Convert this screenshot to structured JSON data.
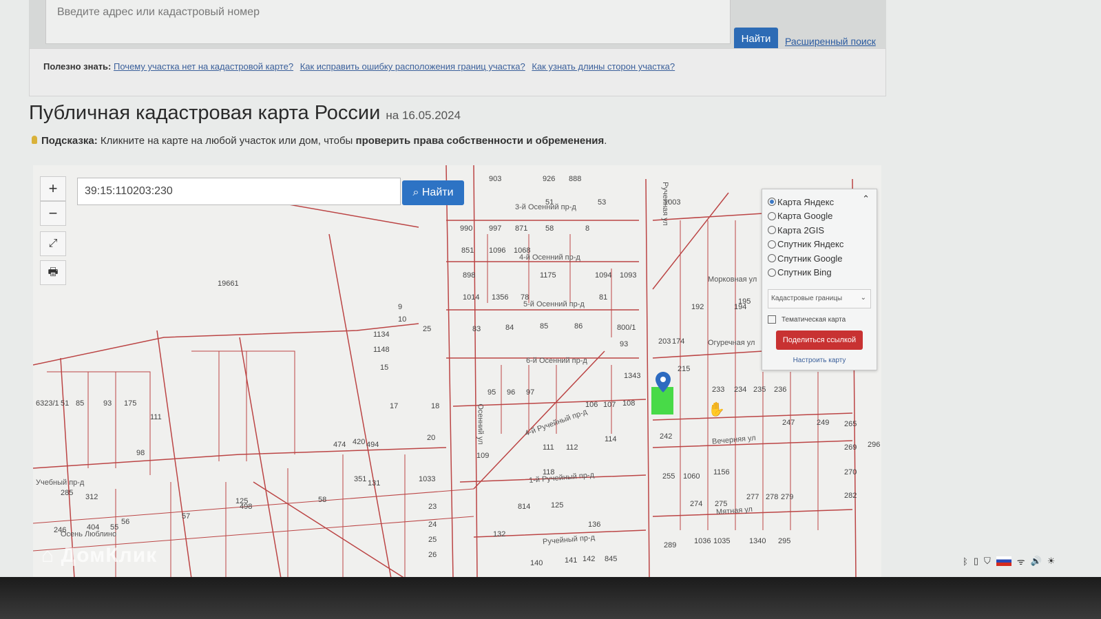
{
  "top": {
    "address_placeholder": "Введите адрес или кадастровый номер",
    "find": "Найти",
    "advanced": "Расширенный поиск"
  },
  "useful": {
    "label": "Полезно знать:",
    "links": [
      "Почему участка нет на кадастровой карте?",
      "Как исправить ошибку расположения границ участка?",
      "Как узнать длины сторон участка?"
    ]
  },
  "title": {
    "main": "Публичная кадастровая карта России",
    "date": "на 16.05.2024"
  },
  "hint": {
    "label": "Подсказка:",
    "text": "Кликните на карте на любой участок или дом, чтобы",
    "bold": "проверить права собственности и обременения",
    "end": "."
  },
  "map": {
    "search_value": "39:15:110203:230",
    "search_btn": "Найти",
    "zoom_in": "+",
    "zoom_out": "−",
    "layers": [
      "Карта Яндекс",
      "Карта Google",
      "Карта 2GIS",
      "Спутник Яндекс",
      "Спутник Google",
      "Спутник Bing"
    ],
    "selected_layer": "Карта Яндекс",
    "overlay_select": "Кадастровые границы",
    "thematic": "Тематическая карта",
    "share": "Поделиться ссылкой",
    "configure": "Настроить карту",
    "streets": [
      "3-й Осенний пр-д",
      "4-й Осенний пр-д",
      "5-й Осенний пр-д",
      "6-й Осенний пр-д",
      "Ручейная ул",
      "Морковная ул",
      "Огуречная ул",
      "Вечерняя ул",
      "Мятная ул",
      "1-й Ручейный пр-д",
      "4-й Ручейный пр-д",
      "Ручейный пр-д",
      "Учебный пр-д",
      "Осенний ул",
      "Осень Люблино"
    ],
    "parcels": [
      "903",
      "926",
      "888",
      "51",
      "53",
      "1003",
      "990",
      "997",
      "871",
      "58",
      "8",
      "851",
      "1096",
      "1068",
      "898",
      "1175",
      "1094",
      "1093",
      "1014",
      "1356",
      "78",
      "81",
      "19661",
      "9",
      "10",
      "25",
      "1134",
      "1148",
      "15",
      "83",
      "84",
      "85",
      "86",
      "800/1",
      "93",
      "17",
      "18",
      "20",
      "95",
      "96",
      "97",
      "109",
      "111",
      "112",
      "114",
      "118",
      "125",
      "814",
      "136",
      "1343",
      "108",
      "107",
      "106",
      "242",
      "255",
      "1060",
      "1156",
      "274",
      "275",
      "277",
      "278",
      "279",
      "289",
      "1036",
      "1035",
      "1340",
      "295",
      "296",
      "270",
      "282",
      "285",
      "6323/1",
      "51",
      "85",
      "93",
      "175",
      "111",
      "98",
      "246",
      "404",
      "55",
      "56",
      "57",
      "58",
      "474",
      "420",
      "494",
      "498",
      "312",
      "125",
      "351",
      "131",
      "1033",
      "23",
      "24",
      "25",
      "26",
      "132",
      "140",
      "141",
      "142",
      "845",
      "203",
      "174",
      "192",
      "194",
      "195",
      "215",
      "233",
      "234",
      "235",
      "236",
      "247",
      "249",
      "265",
      "269"
    ]
  },
  "watermark": "ДомКлик"
}
